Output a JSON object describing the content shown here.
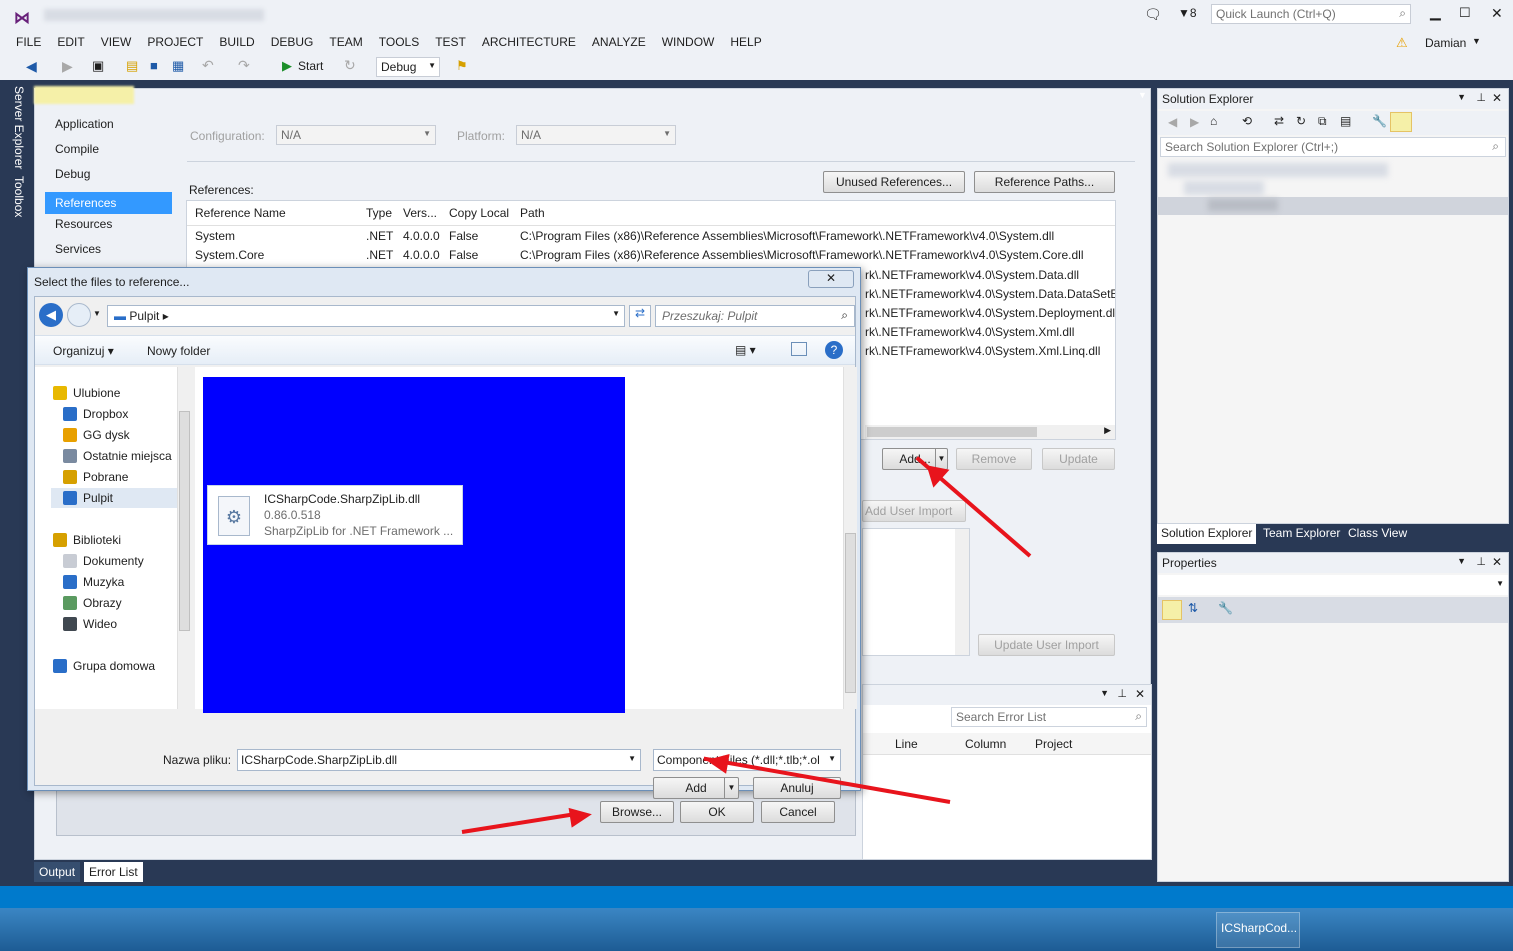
{
  "titlebar": {
    "notifications": "8",
    "quick_launch_placeholder": "Quick Launch (Ctrl+Q)",
    "user": "Damian"
  },
  "menu": [
    "FILE",
    "EDIT",
    "VIEW",
    "PROJECT",
    "BUILD",
    "DEBUG",
    "TEAM",
    "TOOLS",
    "TEST",
    "ARCHITECTURE",
    "ANALYZE",
    "WINDOW",
    "HELP"
  ],
  "toolbar": {
    "start_label": "Start",
    "config_value": "Debug"
  },
  "side_tabs": {
    "server_explorer": "Server Explorer",
    "toolbox": "Toolbox"
  },
  "project_nav": [
    "Application",
    "Compile",
    "Debug",
    "References",
    "Resources",
    "Services"
  ],
  "project_nav_selected": "References",
  "config": {
    "configuration_label": "Configuration:",
    "configuration_value": "N/A",
    "platform_label": "Platform:",
    "platform_value": "N/A"
  },
  "references": {
    "label": "References:",
    "unused_button": "Unused References...",
    "paths_button": "Reference Paths...",
    "columns": [
      "Reference Name",
      "Type",
      "Vers...",
      "Copy Local",
      "Path"
    ],
    "rows": [
      {
        "name": "System",
        "type": ".NET",
        "version": "4.0.0.0",
        "copy": "False",
        "path": "C:\\Program Files (x86)\\Reference Assemblies\\Microsoft\\Framework\\.NETFramework\\v4.0\\System.dll"
      },
      {
        "name": "System.Core",
        "type": ".NET",
        "version": "4.0.0.0",
        "copy": "False",
        "path": "C:\\Program Files (x86)\\Reference Assemblies\\Microsoft\\Framework\\.NETFramework\\v4.0\\System.Core.dll"
      }
    ],
    "visible_path_tails": [
      "rk\\.NETFramework\\v4.0\\System.Data.dll",
      "rk\\.NETFramework\\v4.0\\System.Data.DataSetEx",
      "rk\\.NETFramework\\v4.0\\System.Deployment.dl",
      "rk\\.NETFramework\\v4.0\\System.Xml.dll",
      "rk\\.NETFramework\\v4.0\\System.Xml.Linq.dll"
    ],
    "add_button": "Add...",
    "remove_button": "Remove",
    "update_button": "Update",
    "add_user_import": "Add User Import",
    "update_user_import": "Update User Import"
  },
  "solution_explorer": {
    "title": "Solution Explorer",
    "search_placeholder": "Search Solution Explorer (Ctrl+;)",
    "tabs": [
      "Solution Explorer",
      "Team Explorer",
      "Class View"
    ]
  },
  "properties": {
    "title": "Properties"
  },
  "error_list": {
    "search_placeholder": "Search Error List",
    "columns": [
      "Line",
      "Column",
      "Project"
    ]
  },
  "bottom_tabs": [
    "Output",
    "Error List"
  ],
  "ref_manager_buttons": {
    "browse": "Browse...",
    "ok": "OK",
    "cancel": "Cancel"
  },
  "dialog": {
    "title": "Select the files to reference...",
    "address": "Pulpit",
    "search_placeholder": "Przeszukaj: Pulpit",
    "organize": "Organizuj",
    "new_folder": "Nowy folder",
    "nav_favorites": [
      "Ulubione",
      "Dropbox",
      "GG dysk",
      "Ostatnie miejsca",
      "Pobrane",
      "Pulpit"
    ],
    "nav_libraries": [
      "Biblioteki",
      "Dokumenty",
      "Muzyka",
      "Obrazy",
      "Wideo"
    ],
    "nav_homegroup": "Grupa domowa",
    "file": {
      "name": "ICSharpCode.SharpZipLib.dll",
      "version": "0.86.0.518",
      "description": "SharpZipLib for .NET Framework ..."
    },
    "filename_label": "Nazwa pliku:",
    "filename_value": "ICSharpCode.SharpZipLib.dll",
    "filetype_value": "Component Files (*.dll;*.tlb;*.ol",
    "add_button": "Add",
    "cancel_button": "Anuluj"
  },
  "taskbar": {
    "item": "ICSharpCod..."
  },
  "colors": {
    "accent": "#3399ff",
    "blue_fill": "#0000ff",
    "arrow": "#e8141c",
    "vs_dark": "#293955"
  }
}
